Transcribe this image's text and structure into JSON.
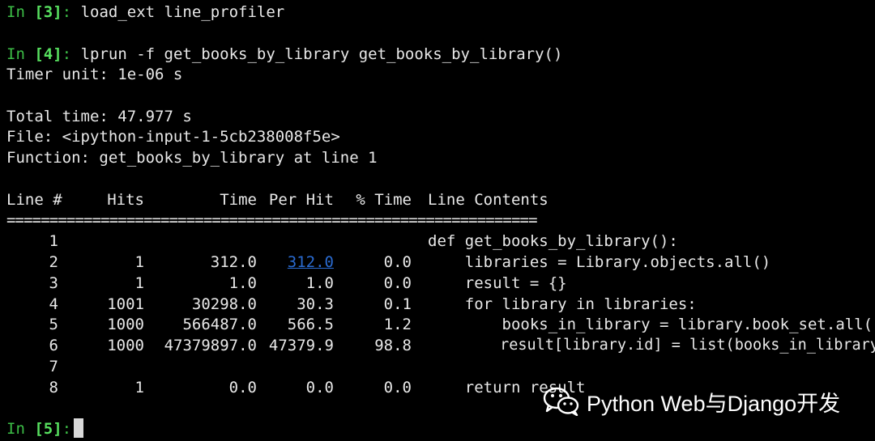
{
  "session": {
    "prompt_label": "In",
    "cell3": {
      "num": "[3]",
      "colon": ":",
      "command": " load_ext line_profiler"
    },
    "cell4": {
      "num": "[4]",
      "colon": ":",
      "command": " lprun -f get_books_by_library get_books_by_library()"
    },
    "cell5": {
      "num": "[5]",
      "colon": ":"
    }
  },
  "output": {
    "timer_unit": "Timer unit: 1e-06 s",
    "total_time": "Total time: 47.977 s",
    "file": "File: <ipython-input-1-5cb238008f5e>",
    "function": "Function: get_books_by_library at line 1"
  },
  "table": {
    "headers": {
      "line": "Line #",
      "hits": "Hits",
      "time": "Time",
      "per_hit": "Per Hit",
      "pct_time": "% Time",
      "contents": "Line Contents"
    },
    "separator": "==============================================================",
    "rows": [
      {
        "line": "1",
        "hits": "",
        "time": "",
        "per_hit": "",
        "pct_time": "",
        "contents": "def get_books_by_library():"
      },
      {
        "line": "2",
        "hits": "1",
        "time": "312.0",
        "per_hit": "312.0",
        "pct_time": "0.0",
        "contents": "    libraries = Library.objects.all()"
      },
      {
        "line": "3",
        "hits": "1",
        "time": "1.0",
        "per_hit": "1.0",
        "pct_time": "0.0",
        "contents": "    result = {}"
      },
      {
        "line": "4",
        "hits": "1001",
        "time": "30298.0",
        "per_hit": "30.3",
        "pct_time": "0.1",
        "contents": "    for library in libraries:"
      },
      {
        "line": "5",
        "hits": "1000",
        "time": "566487.0",
        "per_hit": "566.5",
        "pct_time": "1.2",
        "contents": "        books_in_library = library.book_set.all()"
      },
      {
        "line": "6",
        "hits": "1000",
        "time": "47379897.0",
        "per_hit": "47379.9",
        "pct_time": "98.8",
        "contents": "        result[library.id] = list(books_in_library)"
      },
      {
        "line": "7",
        "hits": "",
        "time": "",
        "per_hit": "",
        "pct_time": "",
        "contents": ""
      },
      {
        "line": "8",
        "hits": "1",
        "time": "0.0",
        "per_hit": "0.0",
        "pct_time": "0.0",
        "contents": "    return result"
      }
    ]
  },
  "watermark": {
    "text": "Python Web与Django开发",
    "icon": "wechat-icon"
  },
  "colors": {
    "prompt": "#3cbd46",
    "prompt_number": "#57e05f",
    "link": "#2a6bd1",
    "background": "#000000",
    "text": "#e8e8e8"
  }
}
